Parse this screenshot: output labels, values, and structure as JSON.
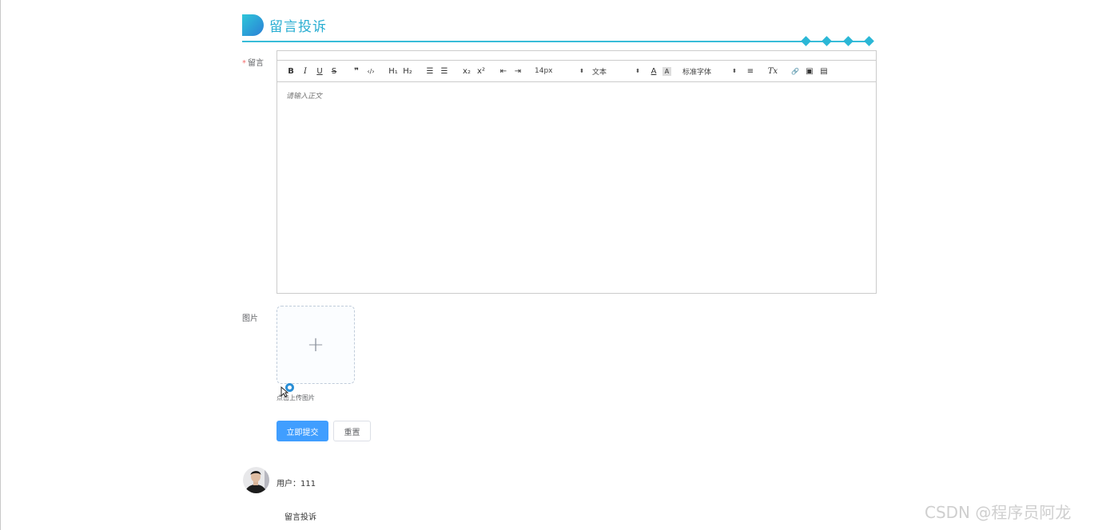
{
  "header": {
    "title": "留言投诉",
    "accent": "#2aaed2"
  },
  "form": {
    "message": {
      "required_mark": "*",
      "label": "留言",
      "placeholder": "请输入正文",
      "toolbar": {
        "bold": "B",
        "italic": "I",
        "underline": "U",
        "strike": "S",
        "quote": "❞",
        "code": "‹/›",
        "h1": "H₁",
        "h2": "H₂",
        "ordered_list": "☰",
        "bullet_list": "☰",
        "subscript": "x₂",
        "superscript": "x²",
        "outdent": "⇤",
        "indent": "⇥",
        "size": "14px",
        "header_picker": "文本",
        "color": "A",
        "background": "A",
        "font": "标准字体",
        "align": "≡",
        "clean": "Tx",
        "link": "🔗",
        "image": "▣",
        "video": "▤"
      }
    },
    "image": {
      "label": "图片",
      "upload_hint": "点击上传图片"
    },
    "submit_label": "立即提交",
    "reset_label": "重置"
  },
  "comment": {
    "user": "用户：111",
    "title": "留言投诉"
  },
  "watermark": "CSDN @程序员阿龙",
  "colors": {
    "primary": "#409eff",
    "header_line": "#38bcd8"
  }
}
